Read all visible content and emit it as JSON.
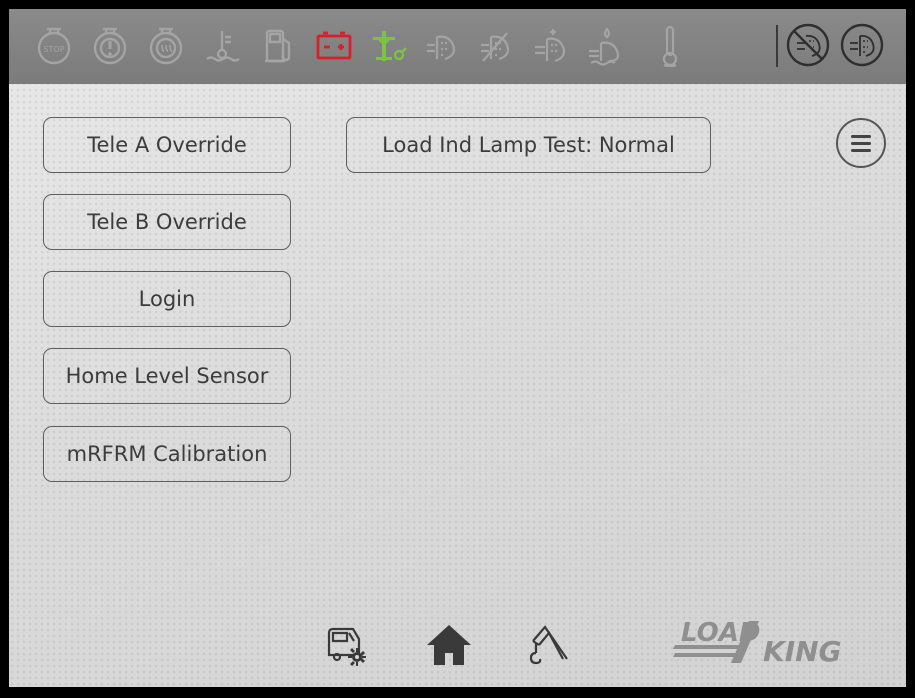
{
  "status_bar": {
    "icons": [
      "stop-lamp-icon",
      "warning-lamp-icon",
      "wait-to-start-icon",
      "coolant-temp-icon",
      "fuel-icon",
      "battery-icon",
      "crane-status-icon",
      "dpf-icon",
      "dpf-icon",
      "dpf-icon",
      "def-level-icon",
      "temperature-gauge-icon",
      "regen-inhibit-icon",
      "dpf-inhibit-icon"
    ],
    "colors": {
      "active_battery": "#d8202a",
      "active_crane": "#7dc242",
      "inactive": "#a4a4a4"
    },
    "stop_label": "STOP"
  },
  "buttons": {
    "tele_a": "Tele A Override",
    "tele_b": "Tele B Override",
    "login": "Login",
    "home_level": "Home Level Sensor",
    "mrfrm": "mRFRM Calibration",
    "load_ind": "Load Ind Lamp Test: Normal"
  },
  "menu": {
    "icon": "hamburger-menu-icon"
  },
  "bottom_nav": {
    "icons": [
      "truck-settings-icon",
      "home-icon",
      "crane-hook-icon"
    ]
  },
  "logo": {
    "part1": "LOAD",
    "part2": "KING"
  }
}
